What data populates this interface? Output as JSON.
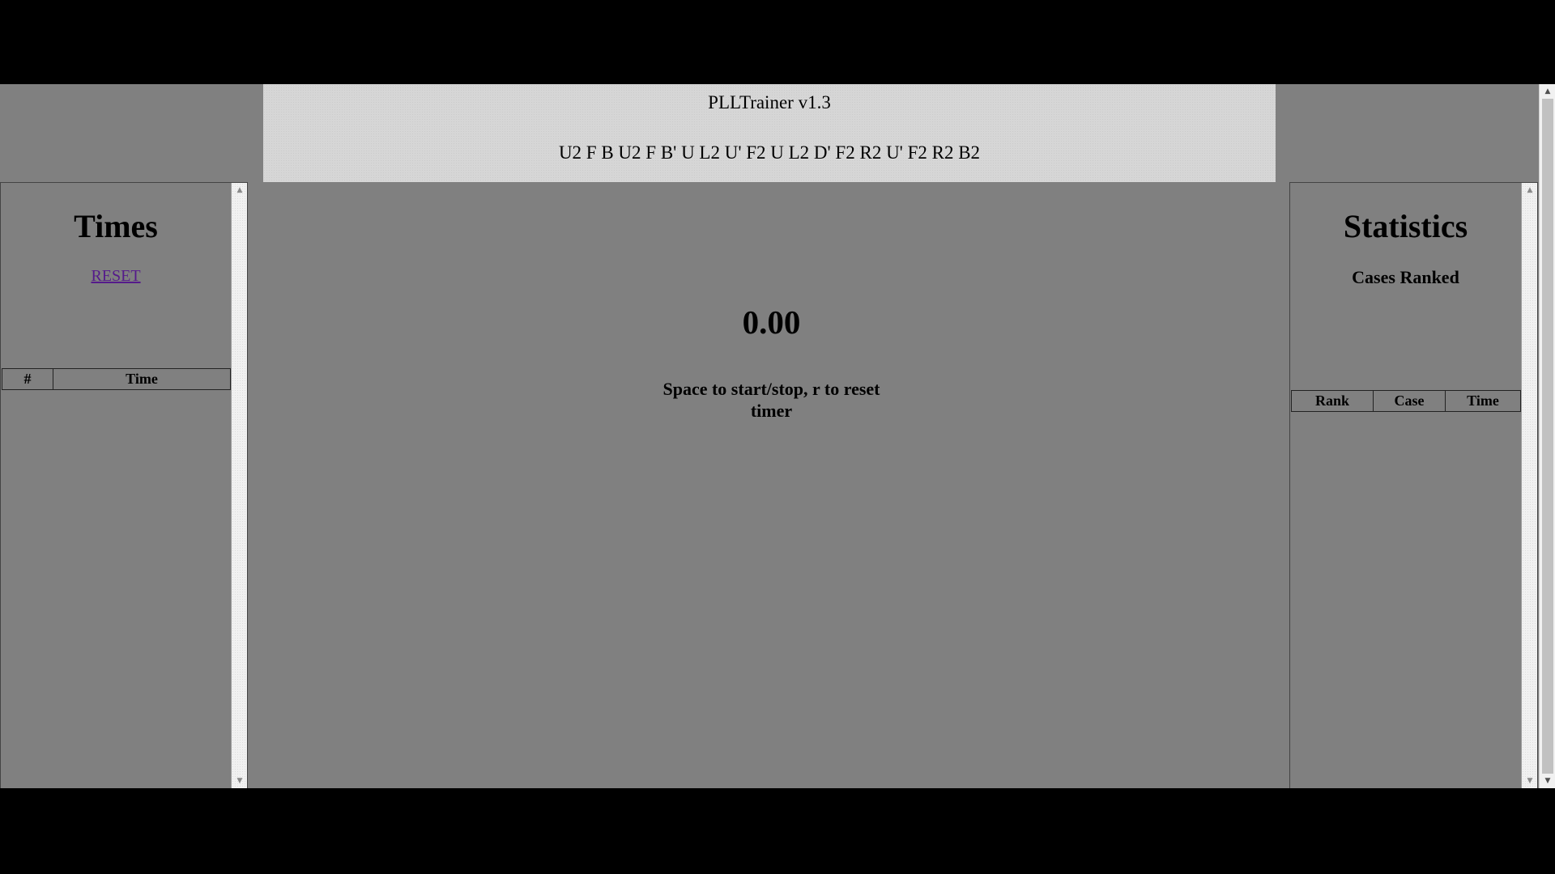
{
  "header": {
    "title": "PLLTrainer v1.3",
    "scramble": "U2 F B U2 F B' U L2 U' F2 U L2 D' F2 R2 U' F2 R2 B2"
  },
  "times_panel": {
    "title": "Times",
    "reset_label": "RESET",
    "columns": [
      "#",
      "Time"
    ],
    "rows": []
  },
  "stats_panel": {
    "title": "Statistics",
    "subtitle": "Cases Ranked",
    "columns": [
      "Rank",
      "Case",
      "Time"
    ],
    "rows": []
  },
  "timer": {
    "value": "0.00",
    "hint": "Space to start/stop, r to reset timer"
  },
  "icons": {
    "scroll_up": "chevron-up-icon",
    "scroll_down": "chevron-down-icon"
  },
  "colors": {
    "background": "#808080",
    "header_background": "#d6d6d6",
    "link": "#551a8b"
  }
}
